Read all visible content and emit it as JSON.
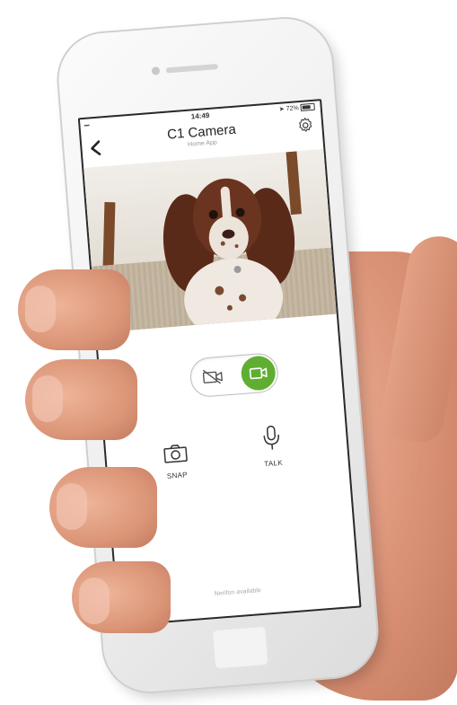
{
  "status_bar": {
    "carrier": "•••••",
    "time": "14:49",
    "battery": "72%"
  },
  "header": {
    "title": "C1 Camera",
    "subtitle": "Home App"
  },
  "video_toggle": {
    "state": "on",
    "on_color": "#5fae32"
  },
  "actions": {
    "snap_label": "SNAP",
    "talk_label": "TALK"
  },
  "footer_note": "Nerifon available",
  "icons": {
    "back": "chevron-left-icon",
    "settings": "gear-icon",
    "video_off": "video-off-icon",
    "video_on": "video-camera-icon",
    "snap": "camera-icon",
    "talk": "microphone-icon"
  }
}
